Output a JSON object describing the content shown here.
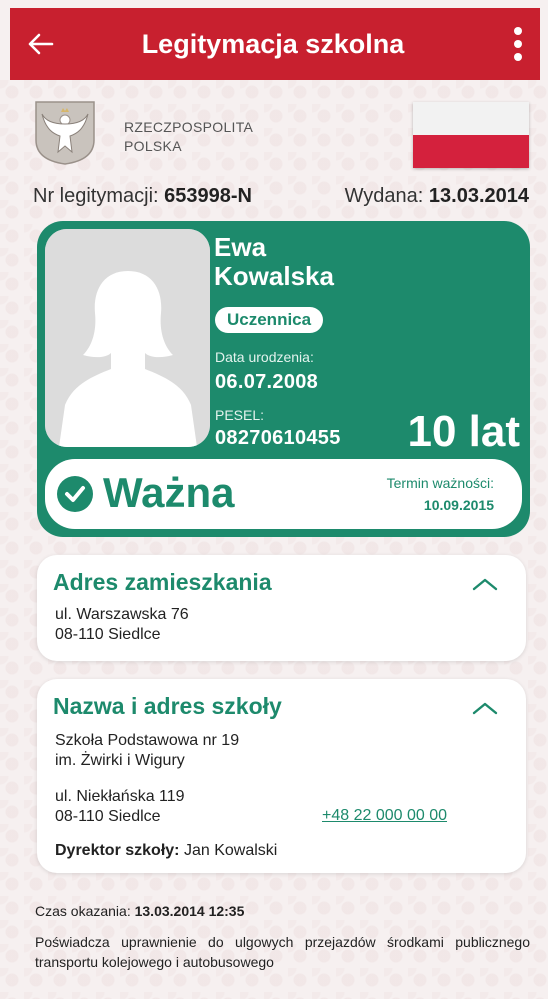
{
  "appbar": {
    "title": "Legitymacja szkolna",
    "back_icon": "arrow-left-icon",
    "menu_icon": "more-vertical-icon",
    "color": "#c8202f"
  },
  "header": {
    "country_line1": "RZECZPOSPOLITA",
    "country_line2": "POLSKA",
    "emblem_icon": "white-eagle-emblem-icon",
    "flag_icon": "polish-flag-icon"
  },
  "document": {
    "nr_label": "Nr legitymacji:",
    "nr_value": "653998-N",
    "issued_label": "Wydana:",
    "issued_value": "13.03.2014"
  },
  "card": {
    "color": "#1d8a6c",
    "first_name": "Ewa",
    "last_name": "Kowalska",
    "role": "Uczennica",
    "dob_label": "Data urodzenia:",
    "dob_value": "06.07.2008",
    "pesel_label": "PESEL:",
    "pesel_value": "08270610455",
    "age": "10 lat",
    "status": "Ważna",
    "expiry_label": "Termin ważności:",
    "expiry_value": "10.09.2015"
  },
  "address": {
    "title": "Adres zamieszkania",
    "line1": "ul. Warszawska 76",
    "line2": "08-110 Siedlce"
  },
  "school": {
    "title": "Nazwa i adres szkoły",
    "name_line1": "Szkoła Podstawowa nr 19",
    "name_line2": "im. Żwirki i Wigury",
    "street": "ul. Niekłańska 119",
    "city": "08-110 Siedlce",
    "phone": "+48 22 000 00 00",
    "director_label": "Dyrektor szkoły:",
    "director_value": "Jan Kowalski"
  },
  "footer": {
    "time_label": "Czas okazania:",
    "time_value": "13.03.2014 12:35",
    "note": "Poświadcza uprawnienie do ulgowych przejazdów środkami publicznego transportu kolejowego i autobusowego"
  }
}
